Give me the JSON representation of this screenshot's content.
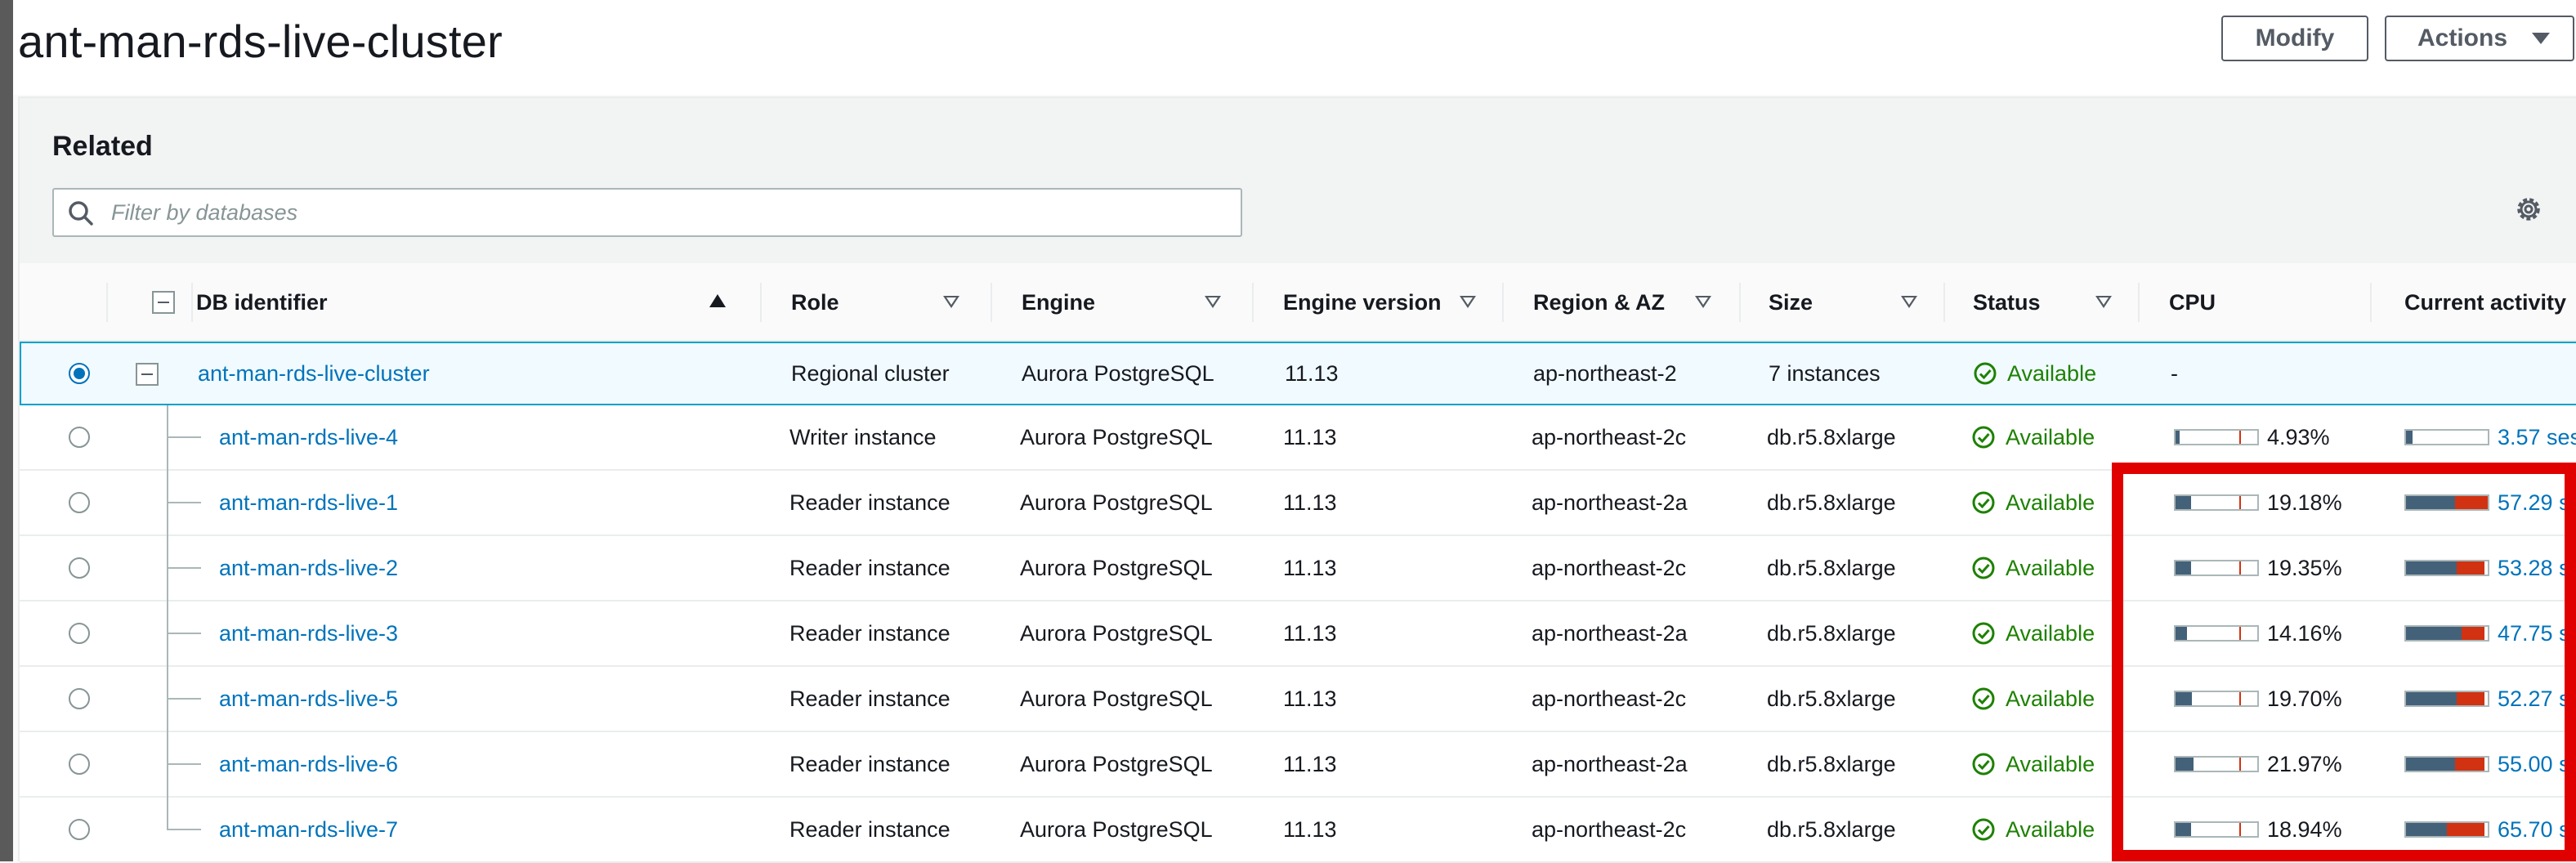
{
  "header": {
    "title": "ant-man-rds-live-cluster",
    "modify_label": "Modify",
    "actions_label": "Actions"
  },
  "panel": {
    "title": "Related",
    "filter_placeholder": "Filter by databases"
  },
  "table": {
    "columns": [
      "DB identifier",
      "Role",
      "Engine",
      "Engine version",
      "Region & AZ",
      "Size",
      "Status",
      "CPU",
      "Current activity"
    ],
    "cluster_row": {
      "identifier": "ant-man-rds-live-cluster",
      "role": "Regional cluster",
      "engine": "Aurora PostgreSQL",
      "version": "11.13",
      "region": "ap-northeast-2",
      "size": "7 instances",
      "status": "Available",
      "cpu": "-"
    },
    "rows": [
      {
        "identifier": "ant-man-rds-live-4",
        "role": "Writer instance",
        "engine": "Aurora PostgreSQL",
        "version": "11.13",
        "region": "ap-northeast-2c",
        "size": "db.r5.8xlarge",
        "status": "Available",
        "cpu": "4.93%",
        "cpu_value": 4.93,
        "activity": "3.57 ses",
        "activity_fill": 0.08,
        "activity_red": 0
      },
      {
        "identifier": "ant-man-rds-live-1",
        "role": "Reader instance",
        "engine": "Aurora PostgreSQL",
        "version": "11.13",
        "region": "ap-northeast-2a",
        "size": "db.r5.8xlarge",
        "status": "Available",
        "cpu": "19.18%",
        "cpu_value": 19.18,
        "activity": "57.29 s",
        "activity_fill": 0.6,
        "activity_red": 0.4
      },
      {
        "identifier": "ant-man-rds-live-2",
        "role": "Reader instance",
        "engine": "Aurora PostgreSQL",
        "version": "11.13",
        "region": "ap-northeast-2c",
        "size": "db.r5.8xlarge",
        "status": "Available",
        "cpu": "19.35%",
        "cpu_value": 19.35,
        "activity": "53.28 s",
        "activity_fill": 0.62,
        "activity_red": 0.34
      },
      {
        "identifier": "ant-man-rds-live-3",
        "role": "Reader instance",
        "engine": "Aurora PostgreSQL",
        "version": "11.13",
        "region": "ap-northeast-2a",
        "size": "db.r5.8xlarge",
        "status": "Available",
        "cpu": "14.16%",
        "cpu_value": 14.16,
        "activity": "47.75 s",
        "activity_fill": 0.68,
        "activity_red": 0.28
      },
      {
        "identifier": "ant-man-rds-live-5",
        "role": "Reader instance",
        "engine": "Aurora PostgreSQL",
        "version": "11.13",
        "region": "ap-northeast-2c",
        "size": "db.r5.8xlarge",
        "status": "Available",
        "cpu": "19.70%",
        "cpu_value": 19.7,
        "activity": "52.27 s",
        "activity_fill": 0.62,
        "activity_red": 0.34
      },
      {
        "identifier": "ant-man-rds-live-6",
        "role": "Reader instance",
        "engine": "Aurora PostgreSQL",
        "version": "11.13",
        "region": "ap-northeast-2a",
        "size": "db.r5.8xlarge",
        "status": "Available",
        "cpu": "21.97%",
        "cpu_value": 21.97,
        "activity": "55.00 s",
        "activity_fill": 0.6,
        "activity_red": 0.36
      },
      {
        "identifier": "ant-man-rds-live-7",
        "role": "Reader instance",
        "engine": "Aurora PostgreSQL",
        "version": "11.13",
        "region": "ap-northeast-2c",
        "size": "db.r5.8xlarge",
        "status": "Available",
        "cpu": "18.94%",
        "cpu_value": 18.94,
        "activity": "65.70 s",
        "activity_fill": 0.5,
        "activity_red": 0.46
      }
    ]
  },
  "colors": {
    "link": "#0073bb",
    "available": "#1d8102",
    "highlight": "#e00000",
    "bar_fill": "#44617a",
    "bar_red": "#d13212"
  }
}
